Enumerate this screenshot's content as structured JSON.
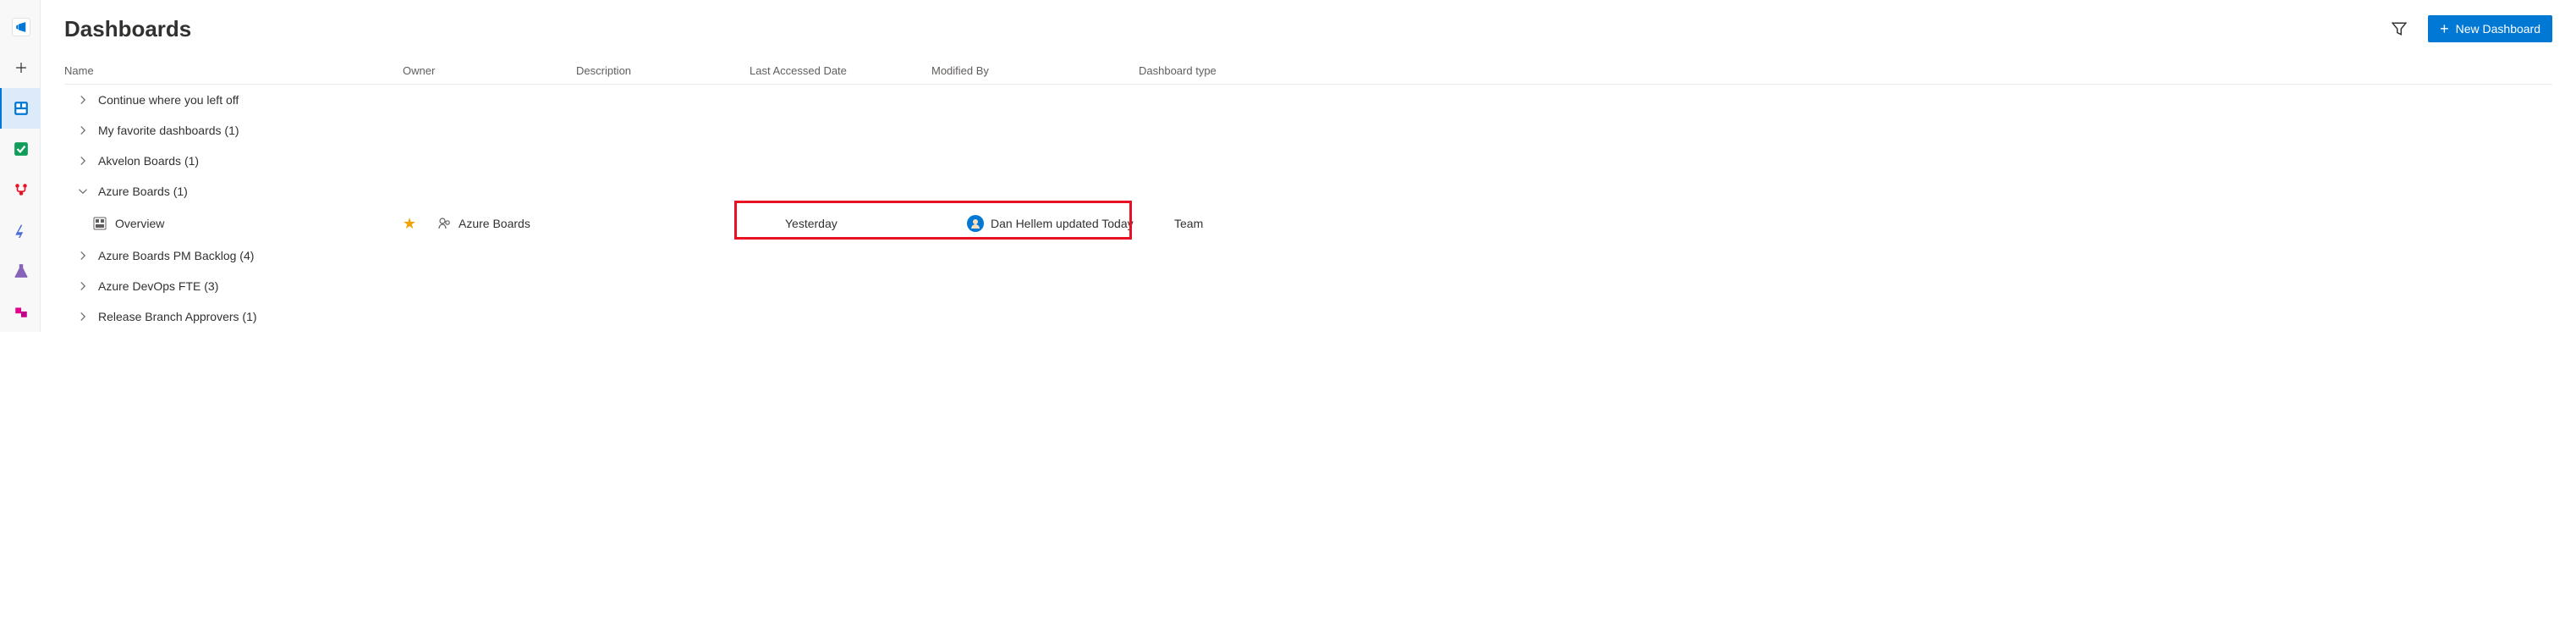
{
  "sidebar": {
    "items": [
      {
        "name": "summary",
        "color": "#0078d4",
        "active": false
      },
      {
        "name": "add",
        "color": "#323130",
        "active": false
      },
      {
        "name": "boards",
        "color": "#0078d4",
        "active": true
      },
      {
        "name": "work",
        "color": "#107c10",
        "active": false
      },
      {
        "name": "repos",
        "color": "#e81123",
        "active": false
      },
      {
        "name": "pipelines",
        "color": "#0078d4",
        "active": false
      },
      {
        "name": "tests",
        "color": "#8764b8",
        "active": false
      },
      {
        "name": "artifacts",
        "color": "#e3008c",
        "active": false
      }
    ]
  },
  "header": {
    "title": "Dashboards",
    "filter_label": "Filter",
    "new_button_label": "New Dashboard"
  },
  "columns": {
    "name": "Name",
    "owner": "Owner",
    "description": "Description",
    "last_accessed": "Last Accessed Date",
    "modified_by": "Modified By",
    "type": "Dashboard type"
  },
  "groups": [
    {
      "label": "Continue where you left off",
      "expanded": false
    },
    {
      "label": "My favorite dashboards (1)",
      "expanded": false
    },
    {
      "label": "Akvelon Boards (1)",
      "expanded": false
    },
    {
      "label": "Azure Boards (1)",
      "expanded": true,
      "dashboards": [
        {
          "name": "Overview",
          "starred": true,
          "owner": "Azure Boards",
          "description": "",
          "last_accessed": "Yesterday",
          "modified_by": "Dan Hellem updated Today",
          "type": "Team"
        }
      ]
    },
    {
      "label": "Azure Boards PM Backlog (4)",
      "expanded": false
    },
    {
      "label": "Azure DevOps FTE (3)",
      "expanded": false
    },
    {
      "label": "Release Branch Approvers (1)",
      "expanded": false
    }
  ]
}
